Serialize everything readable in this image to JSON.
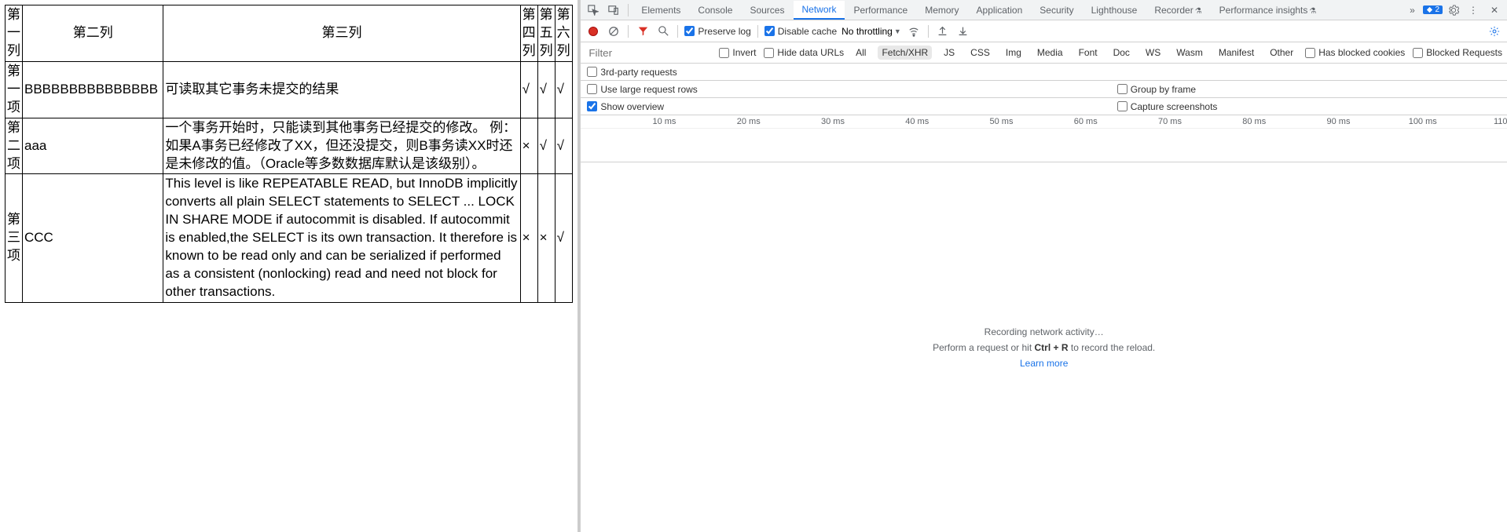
{
  "table": {
    "headers": [
      "第一列",
      "第二列",
      "第三列",
      "第四列",
      "第五列",
      "第六列"
    ],
    "rows": [
      {
        "c1": "第一项",
        "c2": "BBBBBBBBBBBBBBB",
        "c3": "可读取其它事务未提交的结果",
        "c4": "√",
        "c5": "√",
        "c6": "√"
      },
      {
        "c1": "第二项",
        "c2": "aaa",
        "c3": "一个事务开始时，只能读到其他事务已经提交的修改。 例：如果A事务已经修改了XX，但还没提交，则B事务读XX时还是未修改的值。（Oracle等多数数据库默认是该级别）。",
        "c4": "×",
        "c5": "√",
        "c6": "√"
      },
      {
        "c1": "第三项",
        "c2": "CCC",
        "c3": "This level is like REPEATABLE READ, but InnoDB implicitly converts all plain SELECT statements to SELECT ... LOCK IN SHARE MODE if autocommit is disabled. If autocommit is enabled,the SELECT is its own transaction. It therefore is known to be read only and can be serialized if performed as a consistent (nonlocking) read and need not block for other transactions.",
        "c4": "×",
        "c5": "×",
        "c6": "√"
      }
    ]
  },
  "devtools": {
    "mainTabs": [
      "Elements",
      "Console",
      "Sources",
      "Network",
      "Performance",
      "Memory",
      "Application",
      "Security",
      "Lighthouse",
      "Recorder",
      "Performance insights"
    ],
    "activeTab": "Network",
    "issueCount": "2",
    "toolbar": {
      "preserve": "Preserve log",
      "disableCache": "Disable cache",
      "throttling": "No throttling"
    },
    "filter": {
      "placeholder": "Filter",
      "invert": "Invert",
      "hideData": "Hide data URLs",
      "types": [
        "All",
        "Fetch/XHR",
        "JS",
        "CSS",
        "Img",
        "Media",
        "Font",
        "Doc",
        "WS",
        "Wasm",
        "Manifest",
        "Other"
      ],
      "activeType": "Fetch/XHR",
      "blockedCookies": "Has blocked cookies",
      "blockedRequests": "Blocked Requests"
    },
    "opts": {
      "thirdParty": "3rd-party requests",
      "largeRows": "Use large request rows",
      "groupFrame": "Group by frame",
      "showOverview": "Show overview",
      "screenshots": "Capture screenshots"
    },
    "timelineTicks": [
      "10 ms",
      "20 ms",
      "30 ms",
      "40 ms",
      "50 ms",
      "60 ms",
      "70 ms",
      "80 ms",
      "90 ms",
      "100 ms",
      "110"
    ],
    "empty": {
      "line1": "Recording network activity…",
      "line2a": "Perform a request or hit ",
      "line2b": "Ctrl + R",
      "line2c": " to record the reload.",
      "learn": "Learn more"
    }
  }
}
